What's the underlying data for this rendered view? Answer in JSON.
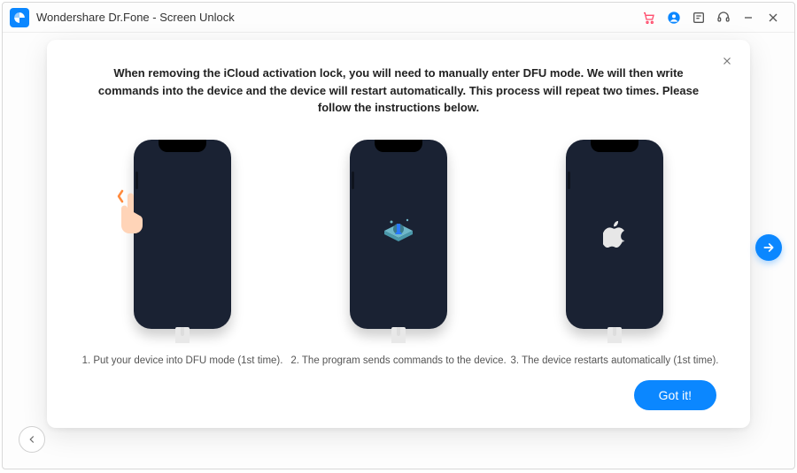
{
  "titlebar": {
    "app_title": "Wondershare Dr.Fone - Screen Unlock"
  },
  "modal": {
    "instructions": "When removing the iCloud activation lock, you will need to manually enter DFU mode. We will then write commands into the device and the device will restart automatically. This process will repeat two times. Please follow the instructions below.",
    "steps": [
      {
        "caption": "1. Put your device into DFU mode (1st time)."
      },
      {
        "caption": "2. The program sends commands to the device."
      },
      {
        "caption": "3. The device restarts automatically (1st time)."
      }
    ],
    "got_it_label": "Got it!"
  }
}
